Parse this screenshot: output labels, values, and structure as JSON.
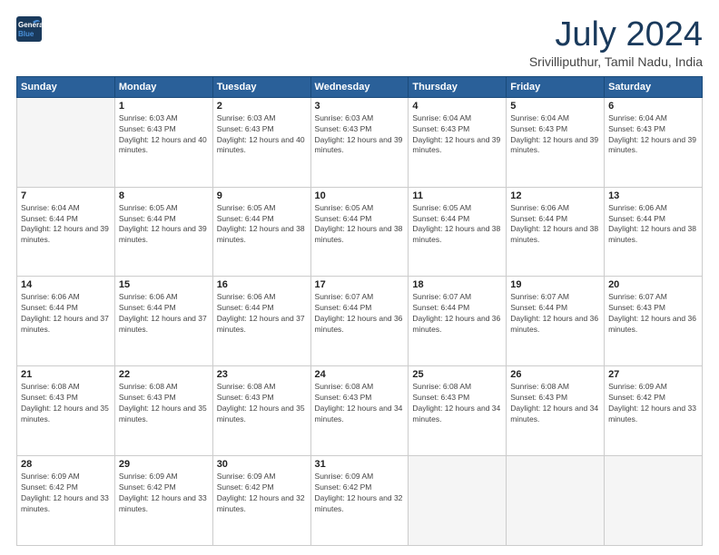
{
  "logo": {
    "line1": "General",
    "line2": "Blue"
  },
  "title": "July 2024",
  "subtitle": "Srivilliputhur, Tamil Nadu, India",
  "days_header": [
    "Sunday",
    "Monday",
    "Tuesday",
    "Wednesday",
    "Thursday",
    "Friday",
    "Saturday"
  ],
  "weeks": [
    [
      {
        "num": "",
        "empty": true
      },
      {
        "num": "1",
        "sunrise": "Sunrise: 6:03 AM",
        "sunset": "Sunset: 6:43 PM",
        "daylight": "Daylight: 12 hours and 40 minutes."
      },
      {
        "num": "2",
        "sunrise": "Sunrise: 6:03 AM",
        "sunset": "Sunset: 6:43 PM",
        "daylight": "Daylight: 12 hours and 40 minutes."
      },
      {
        "num": "3",
        "sunrise": "Sunrise: 6:03 AM",
        "sunset": "Sunset: 6:43 PM",
        "daylight": "Daylight: 12 hours and 39 minutes."
      },
      {
        "num": "4",
        "sunrise": "Sunrise: 6:04 AM",
        "sunset": "Sunset: 6:43 PM",
        "daylight": "Daylight: 12 hours and 39 minutes."
      },
      {
        "num": "5",
        "sunrise": "Sunrise: 6:04 AM",
        "sunset": "Sunset: 6:43 PM",
        "daylight": "Daylight: 12 hours and 39 minutes."
      },
      {
        "num": "6",
        "sunrise": "Sunrise: 6:04 AM",
        "sunset": "Sunset: 6:43 PM",
        "daylight": "Daylight: 12 hours and 39 minutes."
      }
    ],
    [
      {
        "num": "7",
        "sunrise": "Sunrise: 6:04 AM",
        "sunset": "Sunset: 6:44 PM",
        "daylight": "Daylight: 12 hours and 39 minutes."
      },
      {
        "num": "8",
        "sunrise": "Sunrise: 6:05 AM",
        "sunset": "Sunset: 6:44 PM",
        "daylight": "Daylight: 12 hours and 39 minutes."
      },
      {
        "num": "9",
        "sunrise": "Sunrise: 6:05 AM",
        "sunset": "Sunset: 6:44 PM",
        "daylight": "Daylight: 12 hours and 38 minutes."
      },
      {
        "num": "10",
        "sunrise": "Sunrise: 6:05 AM",
        "sunset": "Sunset: 6:44 PM",
        "daylight": "Daylight: 12 hours and 38 minutes."
      },
      {
        "num": "11",
        "sunrise": "Sunrise: 6:05 AM",
        "sunset": "Sunset: 6:44 PM",
        "daylight": "Daylight: 12 hours and 38 minutes."
      },
      {
        "num": "12",
        "sunrise": "Sunrise: 6:06 AM",
        "sunset": "Sunset: 6:44 PM",
        "daylight": "Daylight: 12 hours and 38 minutes."
      },
      {
        "num": "13",
        "sunrise": "Sunrise: 6:06 AM",
        "sunset": "Sunset: 6:44 PM",
        "daylight": "Daylight: 12 hours and 38 minutes."
      }
    ],
    [
      {
        "num": "14",
        "sunrise": "Sunrise: 6:06 AM",
        "sunset": "Sunset: 6:44 PM",
        "daylight": "Daylight: 12 hours and 37 minutes."
      },
      {
        "num": "15",
        "sunrise": "Sunrise: 6:06 AM",
        "sunset": "Sunset: 6:44 PM",
        "daylight": "Daylight: 12 hours and 37 minutes."
      },
      {
        "num": "16",
        "sunrise": "Sunrise: 6:06 AM",
        "sunset": "Sunset: 6:44 PM",
        "daylight": "Daylight: 12 hours and 37 minutes."
      },
      {
        "num": "17",
        "sunrise": "Sunrise: 6:07 AM",
        "sunset": "Sunset: 6:44 PM",
        "daylight": "Daylight: 12 hours and 36 minutes."
      },
      {
        "num": "18",
        "sunrise": "Sunrise: 6:07 AM",
        "sunset": "Sunset: 6:44 PM",
        "daylight": "Daylight: 12 hours and 36 minutes."
      },
      {
        "num": "19",
        "sunrise": "Sunrise: 6:07 AM",
        "sunset": "Sunset: 6:44 PM",
        "daylight": "Daylight: 12 hours and 36 minutes."
      },
      {
        "num": "20",
        "sunrise": "Sunrise: 6:07 AM",
        "sunset": "Sunset: 6:43 PM",
        "daylight": "Daylight: 12 hours and 36 minutes."
      }
    ],
    [
      {
        "num": "21",
        "sunrise": "Sunrise: 6:08 AM",
        "sunset": "Sunset: 6:43 PM",
        "daylight": "Daylight: 12 hours and 35 minutes."
      },
      {
        "num": "22",
        "sunrise": "Sunrise: 6:08 AM",
        "sunset": "Sunset: 6:43 PM",
        "daylight": "Daylight: 12 hours and 35 minutes."
      },
      {
        "num": "23",
        "sunrise": "Sunrise: 6:08 AM",
        "sunset": "Sunset: 6:43 PM",
        "daylight": "Daylight: 12 hours and 35 minutes."
      },
      {
        "num": "24",
        "sunrise": "Sunrise: 6:08 AM",
        "sunset": "Sunset: 6:43 PM",
        "daylight": "Daylight: 12 hours and 34 minutes."
      },
      {
        "num": "25",
        "sunrise": "Sunrise: 6:08 AM",
        "sunset": "Sunset: 6:43 PM",
        "daylight": "Daylight: 12 hours and 34 minutes."
      },
      {
        "num": "26",
        "sunrise": "Sunrise: 6:08 AM",
        "sunset": "Sunset: 6:43 PM",
        "daylight": "Daylight: 12 hours and 34 minutes."
      },
      {
        "num": "27",
        "sunrise": "Sunrise: 6:09 AM",
        "sunset": "Sunset: 6:42 PM",
        "daylight": "Daylight: 12 hours and 33 minutes."
      }
    ],
    [
      {
        "num": "28",
        "sunrise": "Sunrise: 6:09 AM",
        "sunset": "Sunset: 6:42 PM",
        "daylight": "Daylight: 12 hours and 33 minutes."
      },
      {
        "num": "29",
        "sunrise": "Sunrise: 6:09 AM",
        "sunset": "Sunset: 6:42 PM",
        "daylight": "Daylight: 12 hours and 33 minutes."
      },
      {
        "num": "30",
        "sunrise": "Sunrise: 6:09 AM",
        "sunset": "Sunset: 6:42 PM",
        "daylight": "Daylight: 12 hours and 32 minutes."
      },
      {
        "num": "31",
        "sunrise": "Sunrise: 6:09 AM",
        "sunset": "Sunset: 6:42 PM",
        "daylight": "Daylight: 12 hours and 32 minutes."
      },
      {
        "num": "",
        "empty": true
      },
      {
        "num": "",
        "empty": true
      },
      {
        "num": "",
        "empty": true
      }
    ]
  ]
}
